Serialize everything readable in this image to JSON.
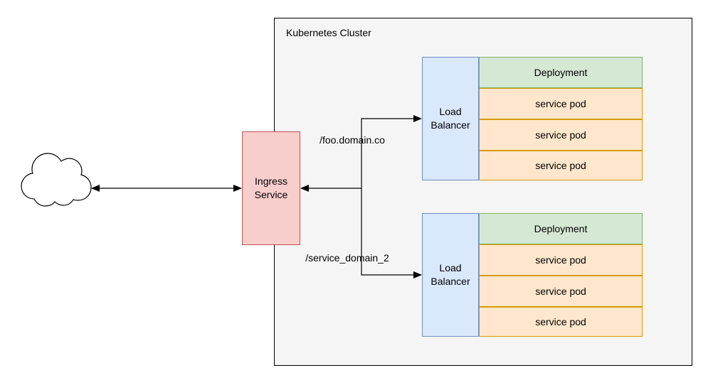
{
  "cluster": {
    "title": "Kubernetes Cluster"
  },
  "ingress": {
    "label": "Ingress Service"
  },
  "routes": {
    "top": "/foo.domain.co",
    "bottom": "/service_domain_2"
  },
  "group_top": {
    "load_balancer": "Load Balancer",
    "deployment": "Deployment",
    "pods": [
      "service pod",
      "service pod",
      "service pod"
    ]
  },
  "group_bottom": {
    "load_balancer": "Load Balancer",
    "deployment": "Deployment",
    "pods": [
      "service pod",
      "service pod",
      "service pod"
    ]
  },
  "icons": {
    "cloud": "cloud"
  }
}
